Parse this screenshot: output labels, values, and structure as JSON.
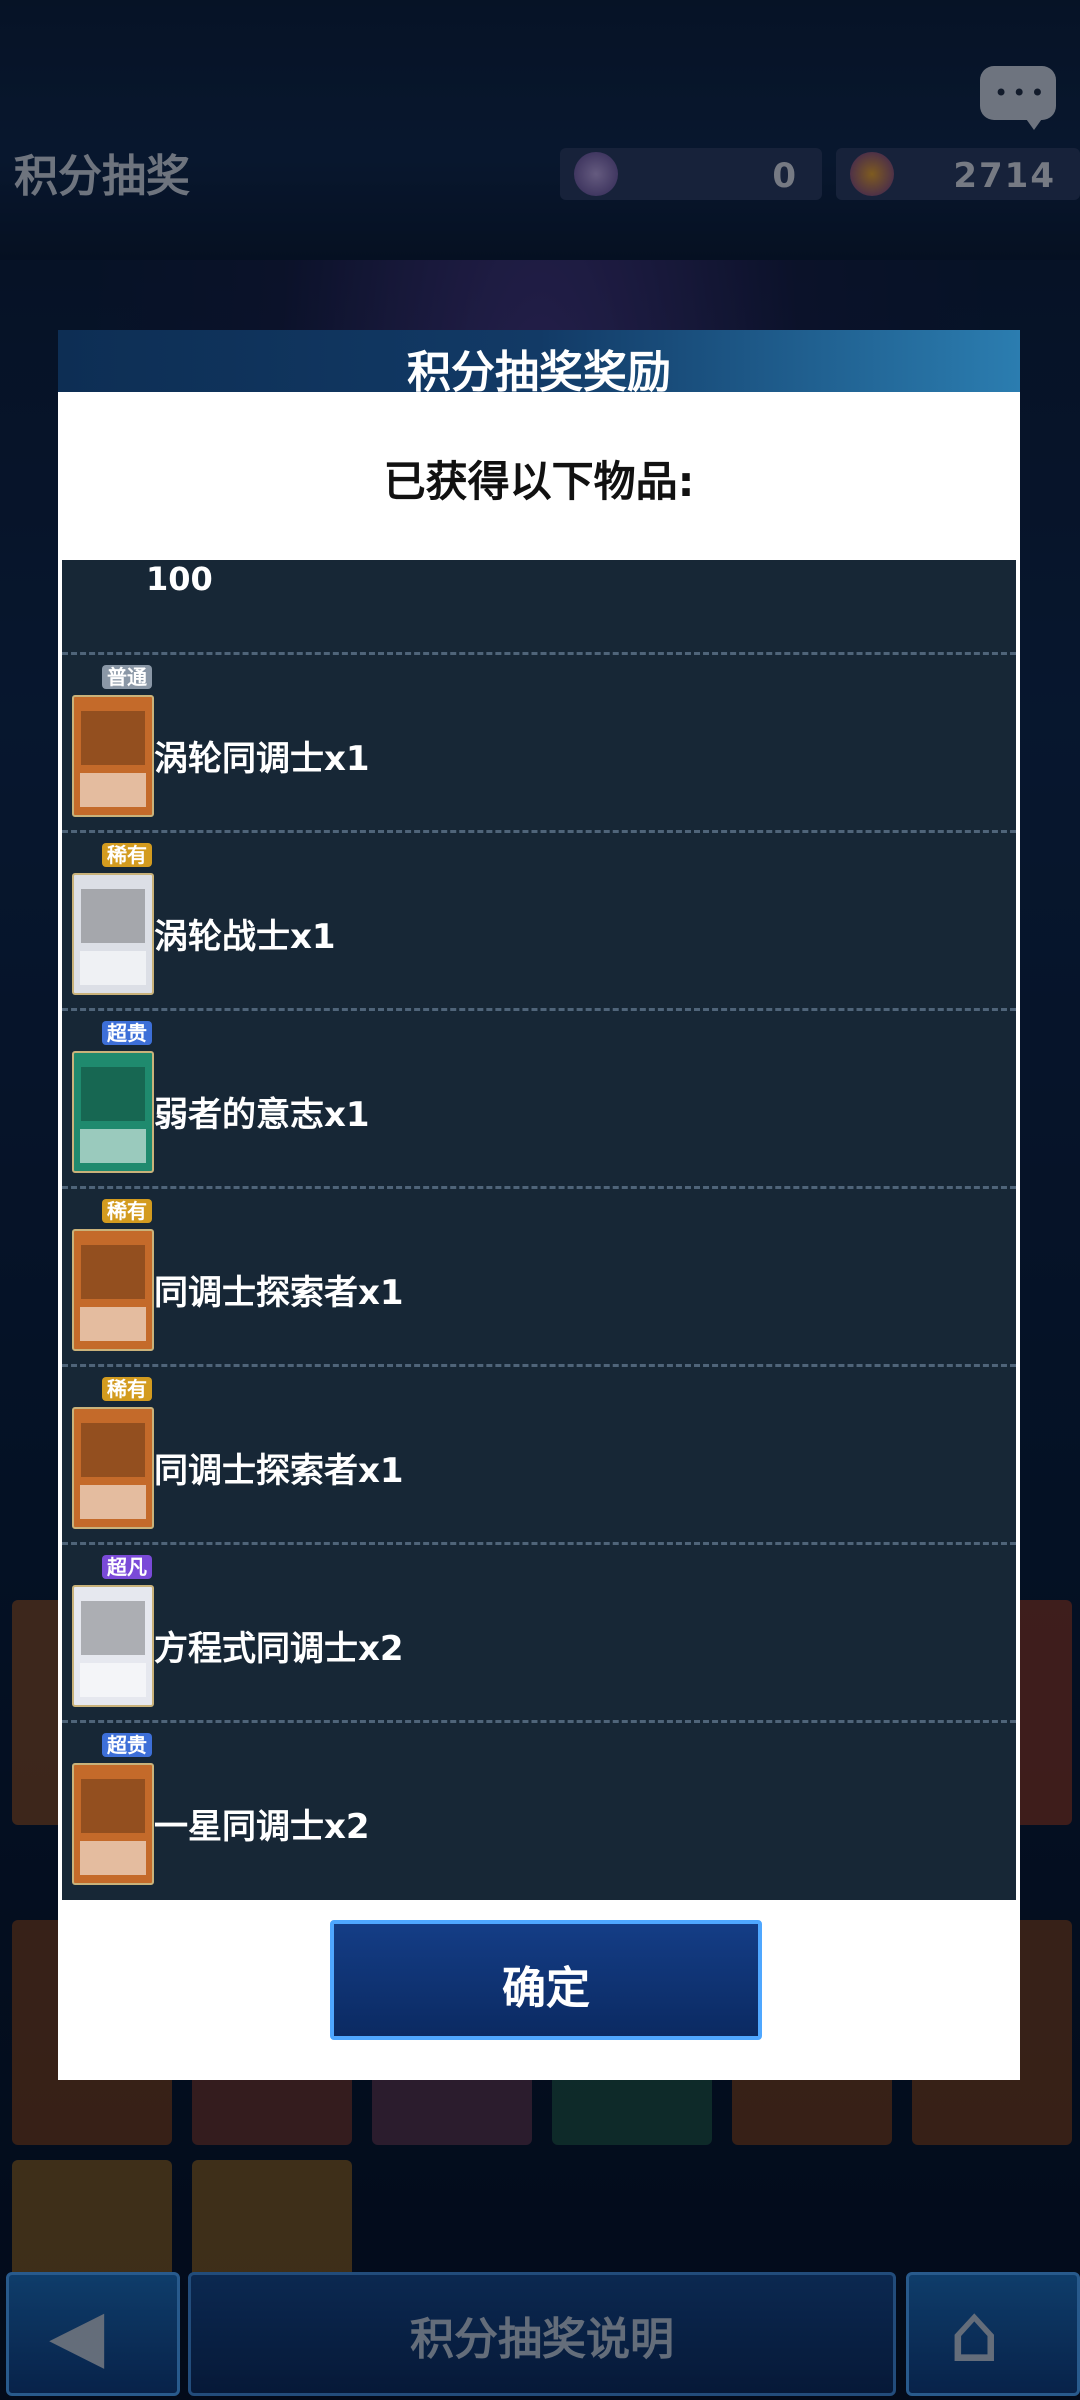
{
  "header": {
    "title": "积分抽奖",
    "currency_a": "0",
    "currency_b": "2714",
    "chat_icon": "chat-bubble-icon"
  },
  "modal": {
    "title": "积分抽奖奖励",
    "subtitle": "已获得以下物品:",
    "partial_amount": "100",
    "items": [
      {
        "rarity": "普通",
        "name": "涡轮同调士",
        "qty": "x1",
        "rarity_color": "#8a97a6",
        "card_color": "#c46a2a"
      },
      {
        "rarity": "稀有",
        "name": "涡轮战士",
        "qty": "x1",
        "rarity_color": "#d39b1f",
        "card_color": "#dcdfe6"
      },
      {
        "rarity": "超贵",
        "name": "弱者的意志",
        "qty": "x1",
        "rarity_color": "#3d6fd8",
        "card_color": "#1f8a6e"
      },
      {
        "rarity": "稀有",
        "name": "同调士探索者",
        "qty": "x1",
        "rarity_color": "#d39b1f",
        "card_color": "#c46a2a"
      },
      {
        "rarity": "稀有",
        "name": "同调士探索者",
        "qty": "x1",
        "rarity_color": "#d39b1f",
        "card_color": "#c46a2a"
      },
      {
        "rarity": "超凡",
        "name": "方程式同调士",
        "qty": "x2",
        "rarity_color": "#7a4ad8",
        "card_color": "#e6e8ef"
      },
      {
        "rarity": "超贵",
        "name": "一星同调士",
        "qty": "x2",
        "rarity_color": "#3d6fd8",
        "card_color": "#c46a2a"
      }
    ],
    "confirm_label": "确定"
  },
  "footer": {
    "back_icon": "arrow-left-icon",
    "help_label": "积分抽奖说明",
    "home_icon": "home-icon"
  }
}
